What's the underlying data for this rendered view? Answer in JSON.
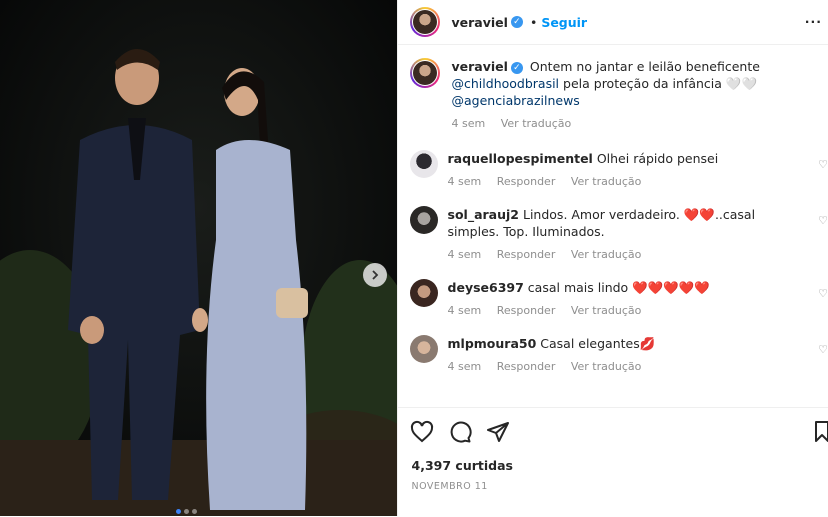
{
  "post": {
    "carousel_dots": 3
  },
  "header": {
    "username": "veraviel",
    "dot": "•",
    "follow_label": "Seguir",
    "more_label": "···"
  },
  "caption": {
    "username": "veraviel",
    "text_1": "Ontem no jantar e leilão beneficente",
    "mention_1": "@childhoodbrasil",
    "text_2": "pela proteção da infância",
    "emoji": "🤍🤍",
    "mention_2": "@agenciabrazilnews",
    "time": "4 sem",
    "translate": "Ver tradução"
  },
  "comments": [
    {
      "username": "raquellopespimentel",
      "text": "Olhei rápido pensei",
      "time": "4 sem",
      "reply": "Responder",
      "translate": "Ver tradução"
    },
    {
      "username": "sol_arauj2",
      "text": "Lindos. Amor verdadeiro. ❤️❤️..casal simples. Top. Iluminados.",
      "time": "4 sem",
      "reply": "Responder",
      "translate": "Ver tradução"
    },
    {
      "username": "deyse6397",
      "text": "casal mais lindo ❤️❤️❤️❤️❤️",
      "time": "4 sem",
      "reply": "Responder",
      "translate": "Ver tradução"
    },
    {
      "username": "mlpmoura50",
      "text": "Casal elegantes💋",
      "time": "4 sem",
      "reply": "Responder",
      "translate": "Ver tradução"
    }
  ],
  "footer": {
    "likes": "4,397 curtidas",
    "date": "NOVEMBRO 11"
  },
  "colors": {
    "accent": "#0095f6",
    "muted": "#8e8e8e",
    "verified": "#3897f0"
  }
}
